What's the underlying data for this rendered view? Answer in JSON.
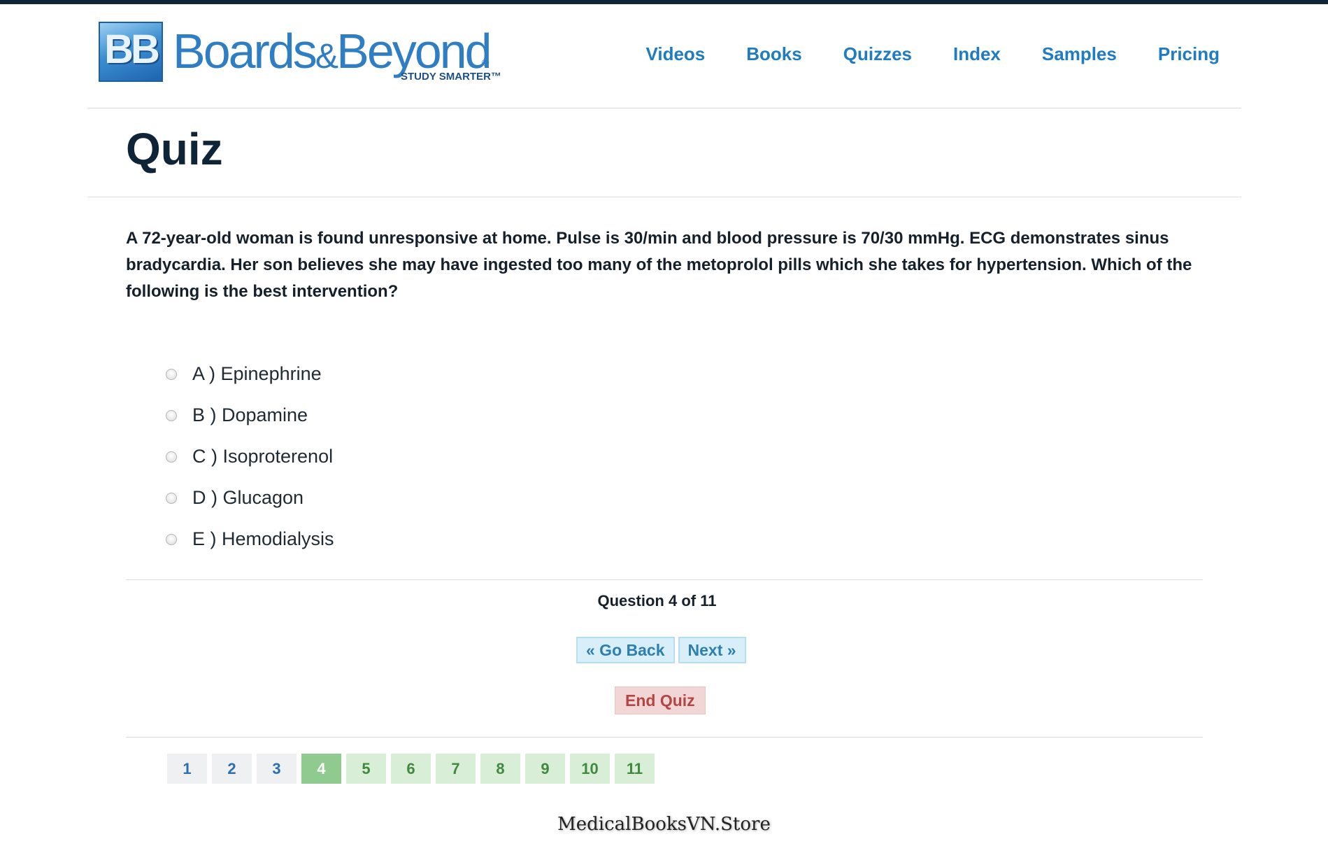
{
  "header": {
    "logo": {
      "mark": "BB",
      "word_left": "Boards",
      "amp": "&",
      "word_right": "Beyond",
      "reg": "®",
      "tagline": "STUDY SMARTER™"
    },
    "nav": [
      "Videos",
      "Books",
      "Quizzes",
      "Index",
      "Samples",
      "Pricing"
    ]
  },
  "main": {
    "title": "Quiz",
    "question": "A 72-year-old woman is found unresponsive at home. Pulse is 30/min and blood pressure is 70/30 mmHg. ECG demonstrates sinus bradycardia. Her son believes she may have ingested too many of the metoprolol pills which she takes for hypertension. Which of the following is the best intervention?",
    "answers": [
      {
        "label": "A ) Epinephrine",
        "selected": false
      },
      {
        "label": "B ) Dopamine",
        "selected": false
      },
      {
        "label": "C ) Isoproterenol",
        "selected": false
      },
      {
        "label": "D ) Glucagon",
        "selected": false
      },
      {
        "label": "E ) Hemodialysis",
        "selected": false
      }
    ],
    "progress": {
      "prefix": "Question",
      "current": "4",
      "of": "of",
      "total": "11"
    },
    "buttons": {
      "back": "« Go Back",
      "next": "Next »",
      "end": "End Quiz"
    },
    "pager": [
      {
        "label": "1",
        "state": "done"
      },
      {
        "label": "2",
        "state": "done"
      },
      {
        "label": "3",
        "state": "done"
      },
      {
        "label": "4",
        "state": "current"
      },
      {
        "label": "5",
        "state": "todo"
      },
      {
        "label": "6",
        "state": "todo"
      },
      {
        "label": "7",
        "state": "todo"
      },
      {
        "label": "8",
        "state": "todo"
      },
      {
        "label": "9",
        "state": "todo"
      },
      {
        "label": "10",
        "state": "todo"
      },
      {
        "label": "11",
        "state": "todo"
      }
    ]
  },
  "watermark": "MedicalBooksVN.Store",
  "colors": {
    "top_bar": "#0f2436",
    "nav_link": "#1f7bc2",
    "pager_current": "#8fcb8f",
    "pager_todo": "#d9eed6",
    "end_button": "#f2d5d5"
  }
}
